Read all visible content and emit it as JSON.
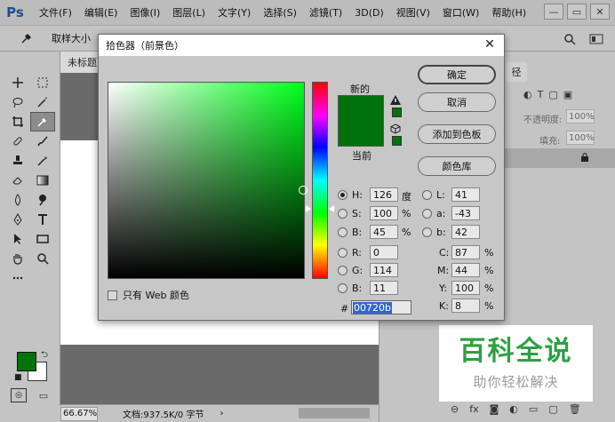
{
  "app": {
    "logo": "Ps",
    "menu": [
      "文件(F)",
      "编辑(E)",
      "图像(I)",
      "图层(L)",
      "文字(Y)",
      "选择(S)",
      "滤镜(T)",
      "3D(D)",
      "视图(V)",
      "窗口(W)",
      "帮助(H)"
    ],
    "window_controls": {
      "minimize": "—",
      "restore": "▭",
      "close": "✕"
    }
  },
  "options_bar": {
    "sample_label": "取样大小"
  },
  "document": {
    "tab_title": "未标题",
    "zoom": "66.67%",
    "doc_info": "文档:937.5K/0 字节",
    "status_arrow": "›"
  },
  "right_panel": {
    "tab_label": "径",
    "opacity_label": "不透明度:",
    "opacity_value": "100%",
    "fill_label": "填充:",
    "fill_value": "100%"
  },
  "dialog": {
    "title": "拾色器（前景色）",
    "close": "✕",
    "label_new": "新的",
    "label_current": "当前",
    "new_color": "#00720b",
    "current_color": "#00720b",
    "buttons": {
      "ok": "确定",
      "cancel": "取消",
      "add_swatch": "添加到色板",
      "color_libraries": "颜色库"
    },
    "web_only_label": "只有 Web 颜色",
    "hsb": {
      "h": {
        "label": "H:",
        "value": "126",
        "unit": "度"
      },
      "s": {
        "label": "S:",
        "value": "100",
        "unit": "%"
      },
      "b": {
        "label": "B:",
        "value": "45",
        "unit": "%"
      }
    },
    "rgb": {
      "r": {
        "label": "R:",
        "value": "0"
      },
      "g": {
        "label": "G:",
        "value": "114"
      },
      "b": {
        "label": "B:",
        "value": "11"
      }
    },
    "lab": {
      "l": {
        "label": "L:",
        "value": "41"
      },
      "a": {
        "label": "a:",
        "value": "-43"
      },
      "b": {
        "label": "b:",
        "value": "42"
      }
    },
    "cmyk": {
      "c": {
        "label": "C:",
        "value": "87",
        "unit": "%"
      },
      "m": {
        "label": "M:",
        "value": "44",
        "unit": "%"
      },
      "y": {
        "label": "Y:",
        "value": "100",
        "unit": "%"
      },
      "k": {
        "label": "K:",
        "value": "8",
        "unit": "%"
      }
    },
    "hex": {
      "label": "#",
      "value": "00720b"
    }
  },
  "watermark": {
    "title": "百科全说",
    "subtitle": "助你轻松解决"
  }
}
